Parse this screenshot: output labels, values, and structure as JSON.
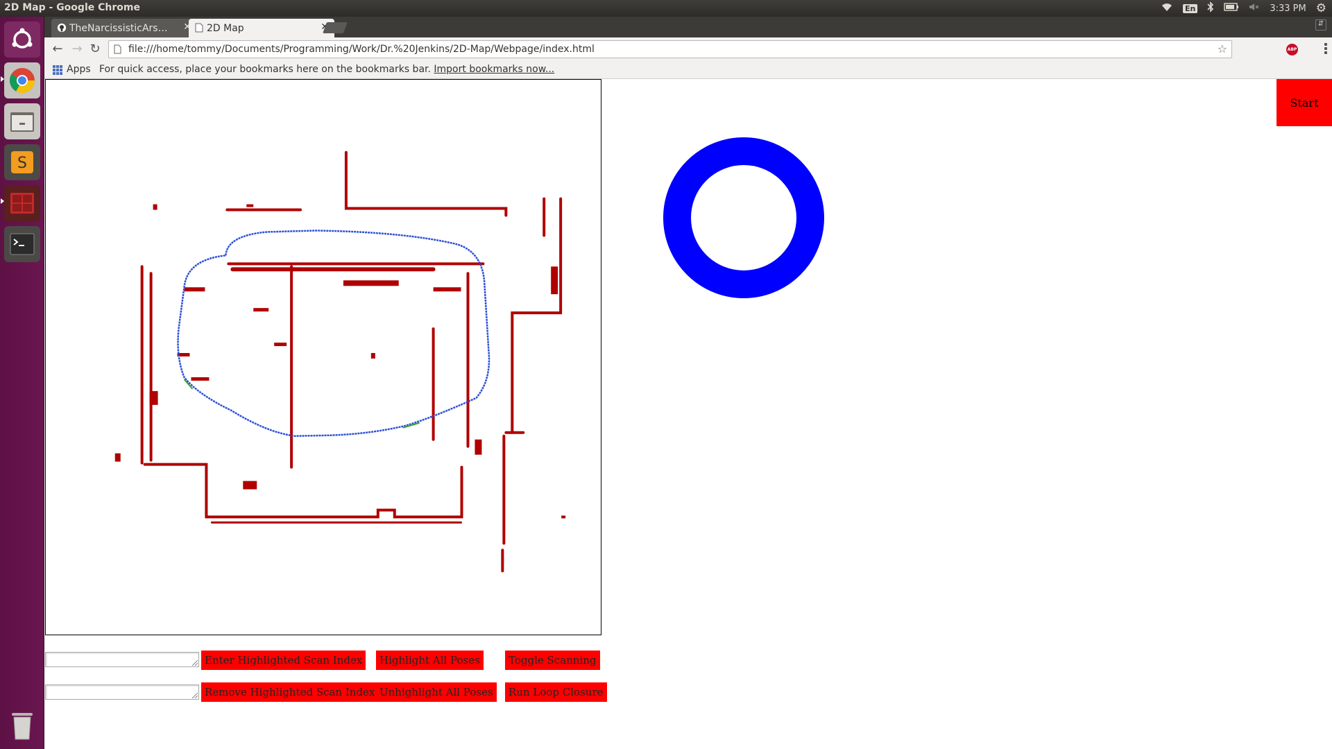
{
  "window": {
    "title": "2D Map - Google Chrome",
    "clock": "3:33 PM",
    "keyboard_layout": "En"
  },
  "launcher": {
    "items": [
      "ubuntu-dash",
      "chrome",
      "files",
      "sublime-text",
      "workspaces",
      "terminal",
      "trash"
    ]
  },
  "tabs": [
    {
      "label": "TheNarcissisticArsenal",
      "active": false,
      "icon": "github-icon"
    },
    {
      "label": "2D Map",
      "active": true,
      "icon": "page-icon"
    }
  ],
  "omnibox": {
    "url": "file:///home/tommy/Documents/Programming/Work/Dr.%20Jenkins/2D-Map/Webpage/index.html"
  },
  "bookmarks": {
    "apps_label": "Apps",
    "prompt": "For quick access, place your bookmarks here on the bookmarks bar.",
    "import_link": "Import bookmarks now..."
  },
  "page": {
    "start_label": "Start",
    "ring_color": "#0000ff",
    "button_color": "#ff0000",
    "map_colors": {
      "walls": "#b00000",
      "path": "#2c4fd6",
      "loop_edge": "#3aa33a"
    },
    "controls": {
      "enter_highlighted": "Enter Highlighted Scan Index",
      "remove_highlighted": "Remove Highlighted Scan Index",
      "highlight_all": "Highlight All Poses",
      "unhighlight_all": "Unhighlight All Poses",
      "toggle_scanning": "Toggle Scanning",
      "run_loop_closure": "Run Loop Closure"
    },
    "inputs": {
      "index_1": "",
      "index_2": ""
    }
  }
}
